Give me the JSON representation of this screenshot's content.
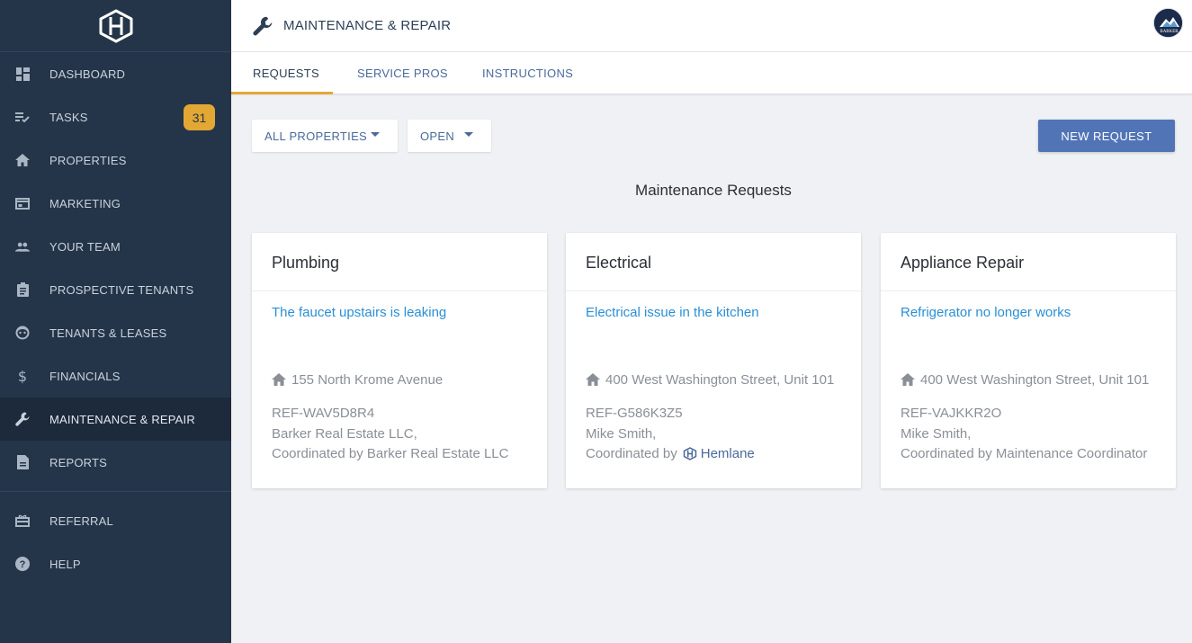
{
  "sidebar": {
    "logo": "hemlane-logo",
    "items": [
      {
        "label": "DASHBOARD",
        "icon": "dashboard-icon"
      },
      {
        "label": "TASKS",
        "icon": "tasks-icon",
        "badge": "31"
      },
      {
        "label": "PROPERTIES",
        "icon": "home-icon"
      },
      {
        "label": "MARKETING",
        "icon": "marketing-icon"
      },
      {
        "label": "YOUR TEAM",
        "icon": "team-icon"
      },
      {
        "label": "PROSPECTIVE TENANTS",
        "icon": "clipboard-icon"
      },
      {
        "label": "TENANTS & LEASES",
        "icon": "tenant-face-icon"
      },
      {
        "label": "FINANCIALS",
        "icon": "dollar-icon"
      },
      {
        "label": "MAINTENANCE & REPAIR",
        "icon": "wrench-icon",
        "active": true
      },
      {
        "label": "REPORTS",
        "icon": "report-icon"
      }
    ],
    "bottom_items": [
      {
        "label": "REFERRAL",
        "icon": "gift-icon"
      },
      {
        "label": "HELP",
        "icon": "help-icon"
      }
    ]
  },
  "header": {
    "title": "MAINTENANCE & REPAIR",
    "icon": "wrench-icon",
    "avatar": "BARKER"
  },
  "tabs": [
    {
      "label": "REQUESTS",
      "active": true
    },
    {
      "label": "SERVICE PROS"
    },
    {
      "label": "INSTRUCTIONS"
    }
  ],
  "filters": {
    "property": "ALL PROPERTIES",
    "status": "OPEN"
  },
  "new_request_label": "NEW REQUEST",
  "section_title": "Maintenance Requests",
  "cards": [
    {
      "category": "Plumbing",
      "description": "The faucet upstairs is leaking",
      "address": "155 North Krome Avenue",
      "ref": "REF-WAV5D8R4",
      "person": "Barker Real Estate LLC,",
      "coordinated": "Coordinated by Barker Real Estate LLC"
    },
    {
      "category": "Electrical",
      "description": "Electrical issue in the kitchen",
      "address": "400 West Washington Street, Unit 101",
      "ref": "REF-G586K3Z5",
      "person": "Mike Smith,",
      "coordinated": "Coordinated by",
      "coordinator_brand": "Hemlane"
    },
    {
      "category": "Appliance Repair",
      "description": "Refrigerator no longer works",
      "address": "400 West Washington Street, Unit 101",
      "ref": "REF-VAJKKR2O",
      "person": "Mike Smith,",
      "coordinated": "Coordinated by Maintenance Coordinator"
    }
  ],
  "colors": {
    "sidebar_bg": "#253549",
    "accent": "#e3a834",
    "primary_button": "#5174b6",
    "link": "#2a8fd6"
  }
}
